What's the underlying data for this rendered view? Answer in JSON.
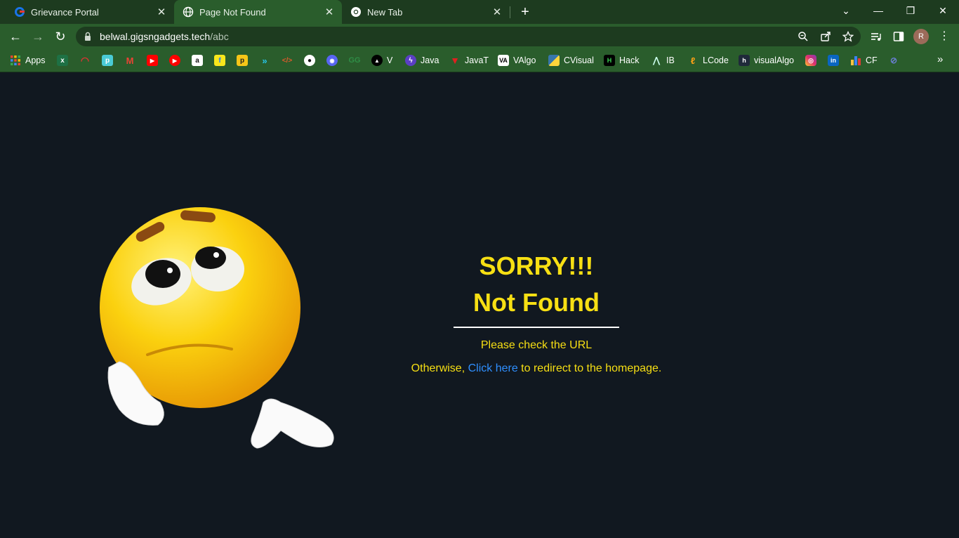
{
  "browser": {
    "tabs": [
      {
        "title": "Grievance Portal",
        "active": false
      },
      {
        "title": "Page Not Found",
        "active": true
      },
      {
        "title": "New Tab",
        "active": false
      }
    ],
    "url": {
      "host": "belwal.gigsngadgets.tech",
      "path": "/abc"
    },
    "profile_initial": "R",
    "accent_color": "#2a5d2c",
    "bookmarks": [
      {
        "label": "Apps",
        "icon": "apps-grid-icon"
      },
      {
        "label": "",
        "icon": "excel-icon"
      },
      {
        "label": "",
        "icon": "speed-gauge-icon"
      },
      {
        "label": "",
        "icon": "tp-link-icon"
      },
      {
        "label": "",
        "icon": "gmail-icon"
      },
      {
        "label": "",
        "icon": "youtube-icon"
      },
      {
        "label": "",
        "icon": "youtube-music-icon"
      },
      {
        "label": "",
        "icon": "amazon-icon"
      },
      {
        "label": "",
        "icon": "flipkart-icon"
      },
      {
        "label": "",
        "icon": "paytm-p-icon"
      },
      {
        "label": "",
        "icon": "arrow-logo-icon"
      },
      {
        "label": "",
        "icon": "code-brackets-icon"
      },
      {
        "label": "",
        "icon": "github-icon"
      },
      {
        "label": "",
        "icon": "discord-icon"
      },
      {
        "label": "",
        "icon": "gfg-icon"
      },
      {
        "label": "V",
        "icon": "triangle-icon"
      },
      {
        "label": "Java",
        "icon": "lightning-icon"
      },
      {
        "label": "JavaT",
        "icon": "red-triangle-icon"
      },
      {
        "label": "VAlgo",
        "icon": "valgo-icon"
      },
      {
        "label": "CVisual",
        "icon": "python-icon"
      },
      {
        "label": "Hack",
        "icon": "hackerrank-icon"
      },
      {
        "label": "IB",
        "icon": "interviewbit-icon"
      },
      {
        "label": "LCode",
        "icon": "leetcode-icon"
      },
      {
        "label": "visualAlgo",
        "icon": "visualalgo-icon"
      },
      {
        "label": "",
        "icon": "instagram-icon"
      },
      {
        "label": "",
        "icon": "linkedin-icon"
      },
      {
        "label": "CF",
        "icon": "codeforces-icon"
      },
      {
        "label": "",
        "icon": "link-icon"
      }
    ]
  },
  "page": {
    "heading1": "SORRY!!!",
    "heading2": "Not Found",
    "check_text": "Please check the URL",
    "redirect_prefix": "Otherwise, ",
    "redirect_link": "Click here",
    "redirect_suffix": " to redirect to the homepage.",
    "text_color": "#f7df13",
    "link_color": "#2f8fff",
    "background_color": "#111820"
  }
}
